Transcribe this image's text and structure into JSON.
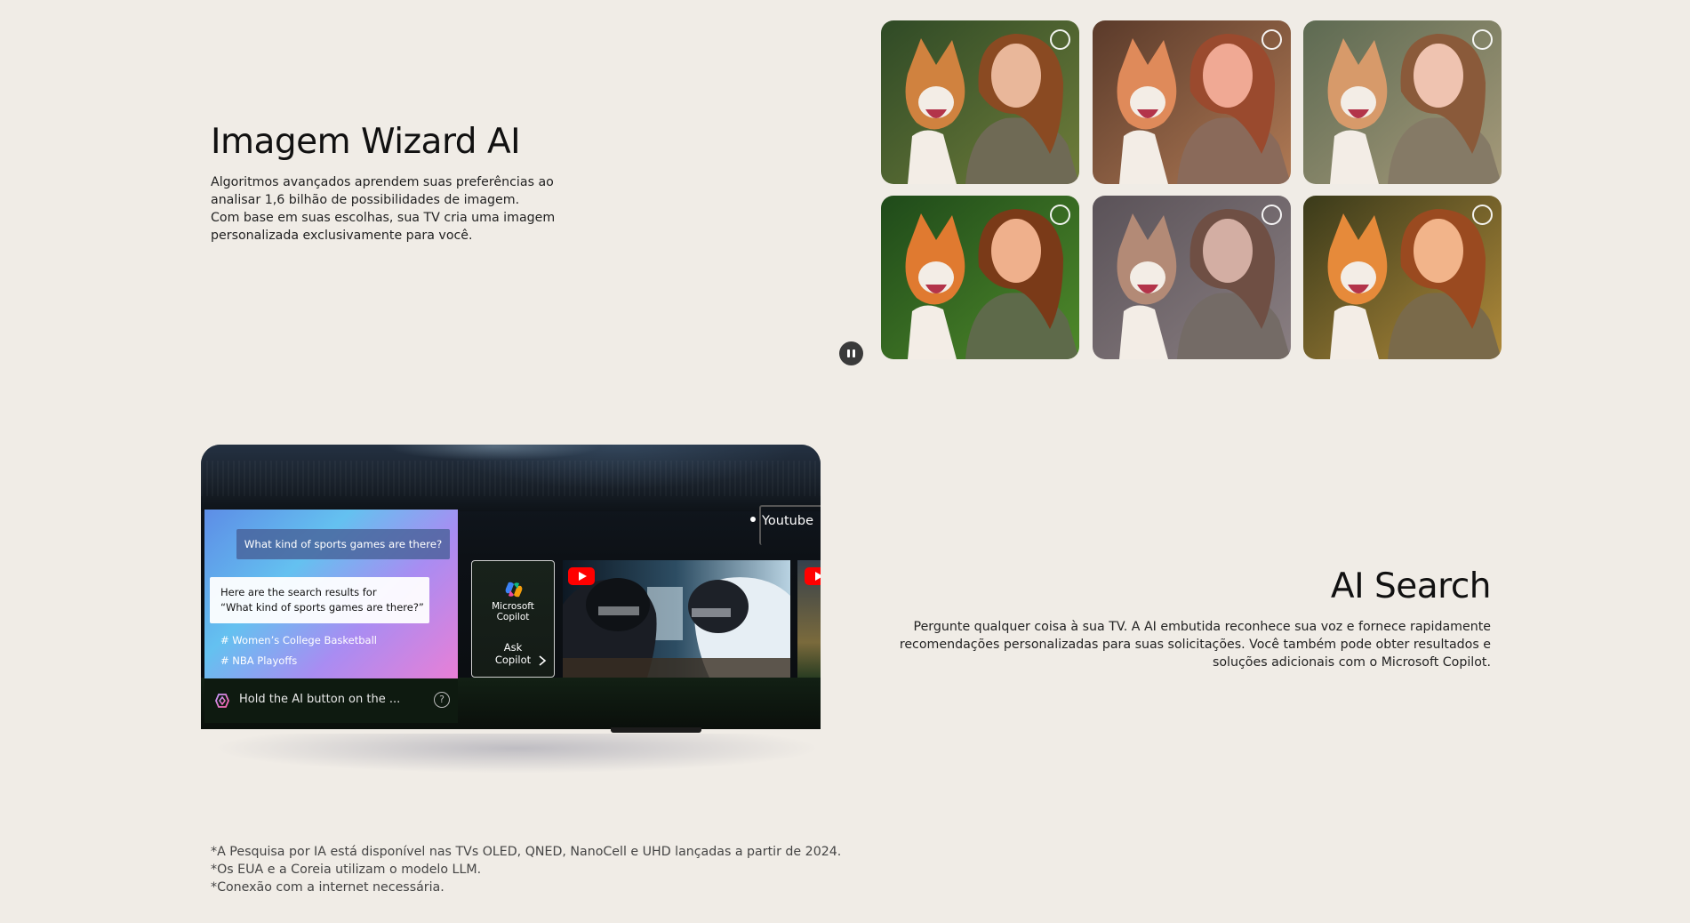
{
  "wizard": {
    "title": "Imagem Wizard AI",
    "description_lines": [
      "Algoritmos avançados aprendem suas preferências ao",
      "analisar 1,6 bilhão de possibilidades de imagem.",
      "Com base em suas escolhas, sua TV cria uma imagem",
      "personalizada exclusivamente para você."
    ],
    "photos": [
      {
        "name": "photo-option-1",
        "tone": "natural"
      },
      {
        "name": "photo-option-2",
        "tone": "warm"
      },
      {
        "name": "photo-option-3",
        "tone": "soft"
      },
      {
        "name": "photo-option-4",
        "tone": "vivid"
      },
      {
        "name": "photo-option-5",
        "tone": "muted"
      },
      {
        "name": "photo-option-6",
        "tone": "golden"
      }
    ],
    "pause_icon": "pause-icon"
  },
  "tv_demo": {
    "ai_question": "What kind of sports games are there?",
    "ai_answer_lines": [
      "Here are the search results for",
      "“What kind of sports games are there?”"
    ],
    "tags": [
      "# Women’s College Basketball",
      "# NBA Playoffs"
    ],
    "hint_text": "Hold the AI button on the ...",
    "help_glyph": "?",
    "youtube_label": "Youtube",
    "copilot": {
      "name_lines": [
        "Microsoft",
        "Copilot"
      ],
      "ask_lines": [
        "Ask",
        "Copilot"
      ]
    }
  },
  "ai_search": {
    "title": "AI Search",
    "description_lines": [
      "Pergunte qualquer coisa à sua TV. A AI embutida reconhece sua voz e fornece rapidamente",
      "recomendações personalizadas para suas solicitações. Você também pode obter resultados e",
      "soluções adicionais com o Microsoft Copilot."
    ]
  },
  "footnotes": [
    "*A Pesquisa por IA está disponível nas TVs OLED, QNED, NanoCell e UHD lançadas a partir de 2024.",
    "*Os EUA e a Coreia utilizam o modelo LLM.",
    "*Conexão com a internet necessária."
  ],
  "colors": {
    "background": "#f0ece6",
    "youtube_red": "#ff0000"
  }
}
